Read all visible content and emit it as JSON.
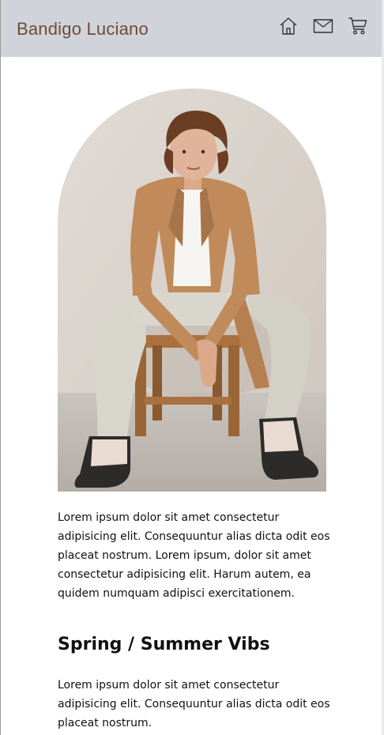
{
  "header": {
    "brand": "Bandigo Luciano",
    "icons": [
      "home-icon",
      "mail-icon",
      "cart-icon"
    ],
    "background": "#d0d3da",
    "brand_color": "#6f4b36"
  },
  "hero": {
    "image_alt": "Young man with curly hair in a tan blazer, white t-shirt, light jeans and sneakers sitting on a wooden stool"
  },
  "content": {
    "paragraph_1": "Lorem ipsum dolor sit amet consectetur adipisicing elit. Consequuntur alias dicta odit eos placeat nostrum. Lorem ipsum, dolor sit amet consectetur adipisicing elit. Harum autem, ea quidem numquam adipisci exercitationem.",
    "section_title": "Spring / Summer Vibs",
    "paragraph_2": "Lorem ipsum dolor sit amet consectetur adipisicing elit. Consequuntur alias dicta odit eos placeat nostrum."
  }
}
